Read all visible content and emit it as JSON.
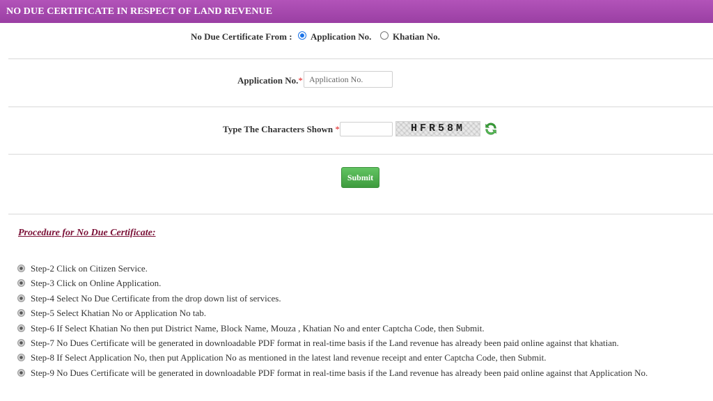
{
  "header": {
    "title": "NO DUE CERTIFICATE IN RESPECT OF LAND REVENUE"
  },
  "form": {
    "certificate_from_label": "No Due Certificate From :",
    "options": [
      "Application No.",
      "Khatian No."
    ],
    "selected_option": "Application No.",
    "application_no_label": "Application No.",
    "application_no_placeholder": "Application No.",
    "application_no_value": "",
    "required_marker": "*",
    "captcha_label": "Type The Characters Shown",
    "captcha_value": "",
    "captcha_text": "HFR58M",
    "submit_label": "Submit"
  },
  "procedure": {
    "title": "Procedure for No Due Certificate:",
    "steps": [
      "Step-2 Click on Citizen Service.",
      "Step-3 Click on Online Application.",
      "Step-4 Select No Due Certificate from the drop down list of services.",
      "Step-5 Select Khatian No or Application No tab.",
      "Step-6 If Select Khatian No then put District Name, Block Name, Mouza , Khatian No and enter Captcha Code, then Submit.",
      "Step-7 No Dues Certificate will be generated in downloadable PDF format in real-time basis if the Land revenue has already been paid online against that khatian.",
      "Step-8 If Select Application No, then put Application No as mentioned in the latest land revenue receipt and enter Captcha Code, then Submit.",
      "Step-9 No Dues Certificate will be generated in downloadable PDF format in real-time basis if the Land revenue has already been paid online against that Application No."
    ]
  },
  "colors": {
    "header_bg": "#a549ad",
    "title_color": "#7a1036",
    "submit_bg": "#4cae4c",
    "required": "#e02020"
  },
  "icons": {
    "refresh": "refresh-icon",
    "bullet": "bullet-icon"
  }
}
